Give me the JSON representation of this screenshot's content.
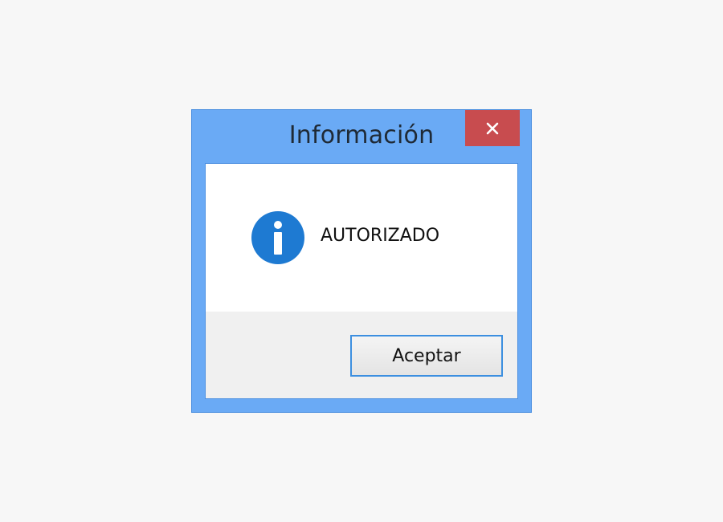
{
  "dialog": {
    "title": "Información",
    "close_icon": "close-icon",
    "message": "AUTORIZADO",
    "icon": "info-icon",
    "ok_label": "Aceptar"
  },
  "colors": {
    "frame": "#6aaaf5",
    "close_button": "#c84c4f",
    "info_icon": "#1e7ad2",
    "footer": "#f0f0f0",
    "button_border": "#3c8fe0"
  }
}
